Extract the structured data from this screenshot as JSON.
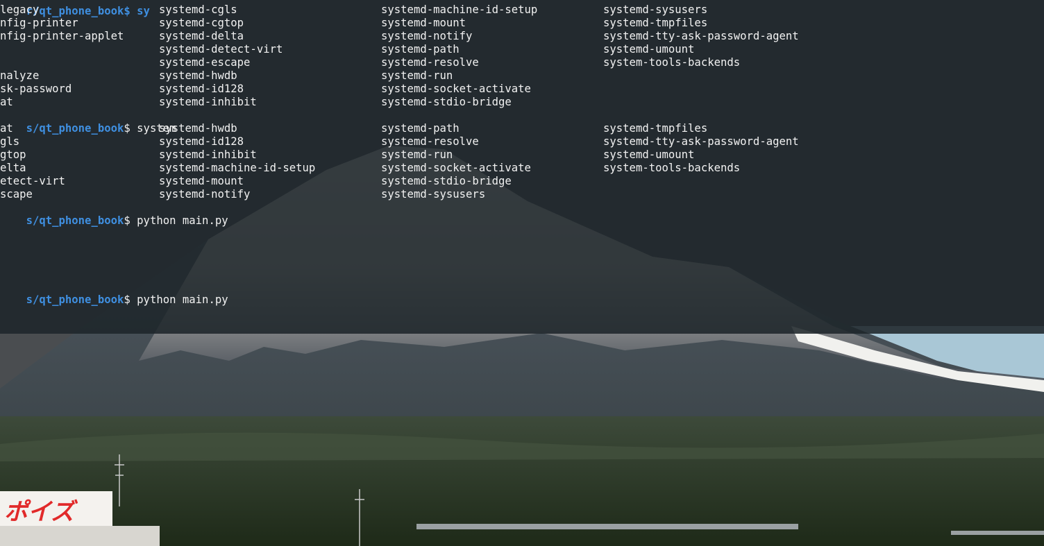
{
  "terminal": {
    "top_partial_prompt": "r/qt_phone_book$ sy",
    "completion1": [
      [
        "legacy",
        "systemd-cgls",
        "systemd-machine-id-setup",
        "systemd-sysusers"
      ],
      [
        "nfig-printer",
        "systemd-cgtop",
        "systemd-mount",
        "systemd-tmpfiles"
      ],
      [
        "nfig-printer-applet",
        "systemd-delta",
        "systemd-notify",
        "systemd-tty-ask-password-agent"
      ],
      [
        "",
        "systemd-detect-virt",
        "systemd-path",
        "systemd-umount"
      ],
      [
        "",
        "systemd-escape",
        "systemd-resolve",
        "system-tools-backends"
      ],
      [
        "nalyze",
        "systemd-hwdb",
        "systemd-run",
        ""
      ],
      [
        "sk-password",
        "systemd-id128",
        "systemd-socket-activate",
        ""
      ],
      [
        "at",
        "systemd-inhibit",
        "systemd-stdio-bridge",
        ""
      ]
    ],
    "prompt_path": "s/qt_phone_book",
    "prompt_symbol": "$",
    "cmd_system": " system",
    "completion2": [
      [
        "at",
        "systemd-hwdb",
        "systemd-path",
        "systemd-tmpfiles"
      ],
      [
        "gls",
        "systemd-id128",
        "systemd-resolve",
        "systemd-tty-ask-password-agent"
      ],
      [
        "gtop",
        "systemd-inhibit",
        "systemd-run",
        "systemd-umount"
      ],
      [
        "elta",
        "systemd-machine-id-setup",
        "systemd-socket-activate",
        "system-tools-backends"
      ],
      [
        "etect-virt",
        "systemd-mount",
        "systemd-stdio-bridge",
        ""
      ],
      [
        "scape",
        "systemd-notify",
        "systemd-sysusers",
        ""
      ]
    ],
    "cmd_python1": " python main.py",
    "cmd_python2": " python main.py",
    "cmd_empty": ""
  },
  "background": {
    "sign_text": "ポイズ"
  },
  "colors": {
    "terminal_bg": "#1e252a",
    "text": "#f2f2f2",
    "prompt_path": "#3f8fe0"
  }
}
